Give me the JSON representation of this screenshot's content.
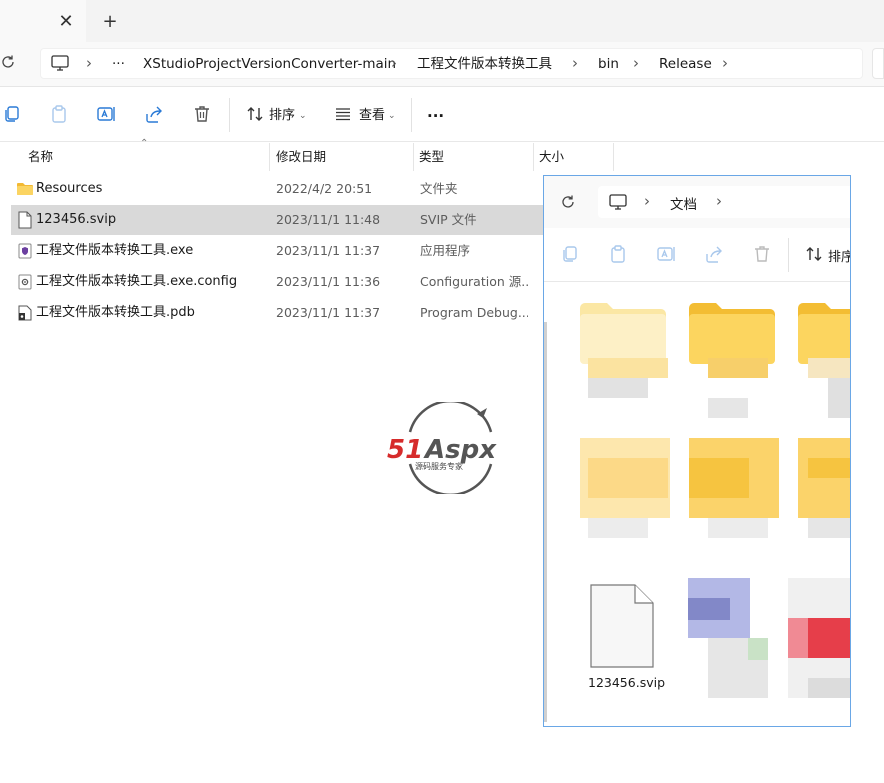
{
  "tabbar": {
    "close_icon": "close-icon",
    "newtab_icon": "plus-icon"
  },
  "nav": {
    "refresh_icon": "refresh-icon",
    "breadcrumbs": [
      "XStudioProjectVersionConverter-main",
      "工程文件版本转换工具",
      "bin",
      "Release"
    ],
    "overflow": "···"
  },
  "toolbar": {
    "sort_label": "排序",
    "view_label": "查看",
    "more_label": "···"
  },
  "columns": {
    "name": "名称",
    "modified": "修改日期",
    "type": "类型",
    "size": "大小"
  },
  "files": [
    {
      "name": "Resources",
      "modified": "2022/4/2 20:51",
      "type": "文件夹",
      "icon": "folder-icon",
      "selected": false
    },
    {
      "name": "123456.svip",
      "modified": "2023/11/1 11:48",
      "type": "SVIP 文件",
      "icon": "file-icon",
      "selected": true
    },
    {
      "name": "工程文件版本转换工具.exe",
      "modified": "2023/11/1 11:37",
      "type": "应用程序",
      "icon": "exe-icon",
      "selected": false
    },
    {
      "name": "工程文件版本转换工具.exe.config",
      "modified": "2023/11/1 11:36",
      "type": "Configuration 源...",
      "icon": "config-icon",
      "selected": false
    },
    {
      "name": "工程文件版本转换工具.pdb",
      "modified": "2023/11/1 11:37",
      "type": "Program Debug...",
      "icon": "pdb-icon",
      "selected": false
    }
  ],
  "watermark": {
    "brand": "51Aspx",
    "tagline": "源码服务专家"
  },
  "window2": {
    "breadcrumb": "文档",
    "sort_label": "排序",
    "svip_file_label": "123456.svip"
  },
  "colors": {
    "accent": "#0067c0",
    "folder": "#f7c94b",
    "selection": "#d9d9d9",
    "window_border": "#6aa7e6"
  }
}
